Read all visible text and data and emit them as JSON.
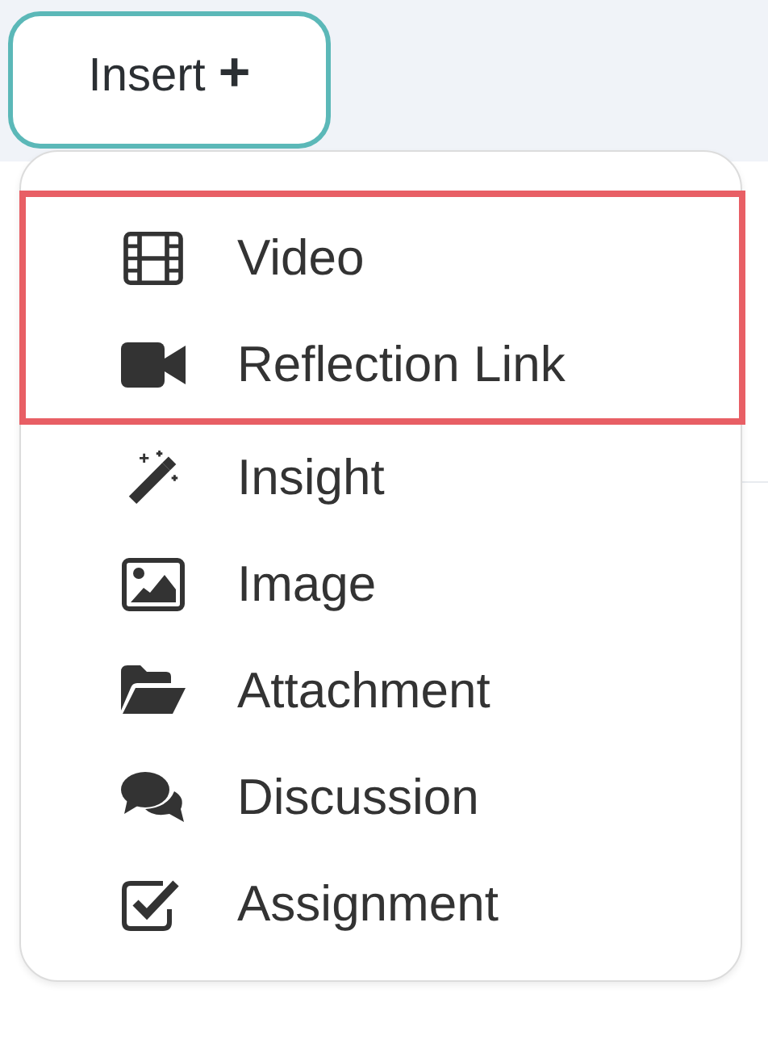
{
  "insert_button": {
    "label": "Insert",
    "icon": "+"
  },
  "menu": {
    "highlighted_items": [
      {
        "kind": "video",
        "label": "Video"
      },
      {
        "kind": "camera",
        "label": "Reflection Link"
      }
    ],
    "items": [
      {
        "kind": "wand",
        "label": "Insight"
      },
      {
        "kind": "image",
        "label": "Image"
      },
      {
        "kind": "folder",
        "label": "Attachment"
      },
      {
        "kind": "comments",
        "label": "Discussion"
      },
      {
        "kind": "check",
        "label": "Assignment"
      }
    ]
  }
}
